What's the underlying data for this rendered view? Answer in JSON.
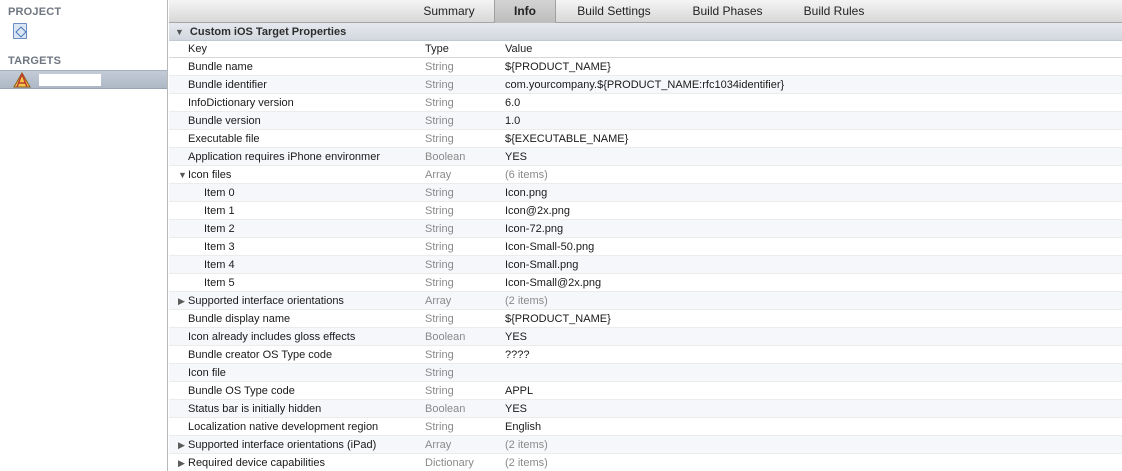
{
  "sidebar": {
    "project_header": "PROJECT",
    "targets_header": "TARGETS"
  },
  "tabs": [
    "Summary",
    "Info",
    "Build Settings",
    "Build Phases",
    "Build Rules"
  ],
  "active_tab": "Info",
  "group": {
    "title": "Custom iOS Target Properties"
  },
  "columns": {
    "key": "Key",
    "type": "Type",
    "value": "Value"
  },
  "rows": [
    {
      "key": "Bundle name",
      "type": "String",
      "value": "${PRODUCT_NAME}"
    },
    {
      "key": "Bundle identifier",
      "type": "String",
      "value": "com.yourcompany.${PRODUCT_NAME:rfc1034identifier}"
    },
    {
      "key": "InfoDictionary version",
      "type": "String",
      "value": "6.0"
    },
    {
      "key": "Bundle version",
      "type": "String",
      "value": "1.0"
    },
    {
      "key": "Executable file",
      "type": "String",
      "value": "${EXECUTABLE_NAME}"
    },
    {
      "key": "Application requires iPhone environmer",
      "type": "Boolean",
      "value": "YES"
    },
    {
      "key": "Icon files",
      "type": "Array",
      "value": "(6 items)",
      "disclosure": "expanded"
    },
    {
      "key": "Item 0",
      "type": "String",
      "value": "Icon.png",
      "child": true
    },
    {
      "key": "Item 1",
      "type": "String",
      "value": "Icon@2x.png",
      "child": true
    },
    {
      "key": "Item 2",
      "type": "String",
      "value": "Icon-72.png",
      "child": true
    },
    {
      "key": "Item 3",
      "type": "String",
      "value": "Icon-Small-50.png",
      "child": true
    },
    {
      "key": "Item 4",
      "type": "String",
      "value": "Icon-Small.png",
      "child": true
    },
    {
      "key": "Item 5",
      "type": "String",
      "value": "Icon-Small@2x.png",
      "child": true
    },
    {
      "key": "Supported interface orientations",
      "type": "Array",
      "value": "(2 items)",
      "disclosure": "collapsed"
    },
    {
      "key": "Bundle display name",
      "type": "String",
      "value": "${PRODUCT_NAME}"
    },
    {
      "key": "Icon already includes gloss effects",
      "type": "Boolean",
      "value": "YES"
    },
    {
      "key": "Bundle creator OS Type code",
      "type": "String",
      "value": "????"
    },
    {
      "key": "Icon file",
      "type": "String",
      "value": ""
    },
    {
      "key": "Bundle OS Type code",
      "type": "String",
      "value": "APPL"
    },
    {
      "key": "Status bar is initially hidden",
      "type": "Boolean",
      "value": "YES"
    },
    {
      "key": "Localization native development region",
      "type": "String",
      "value": "English"
    },
    {
      "key": "Supported interface orientations (iPad)",
      "type": "Array",
      "value": "(2 items)",
      "disclosure": "collapsed"
    },
    {
      "key": "Required device capabilities",
      "type": "Dictionary",
      "value": "(2 items)",
      "disclosure": "collapsed"
    }
  ]
}
